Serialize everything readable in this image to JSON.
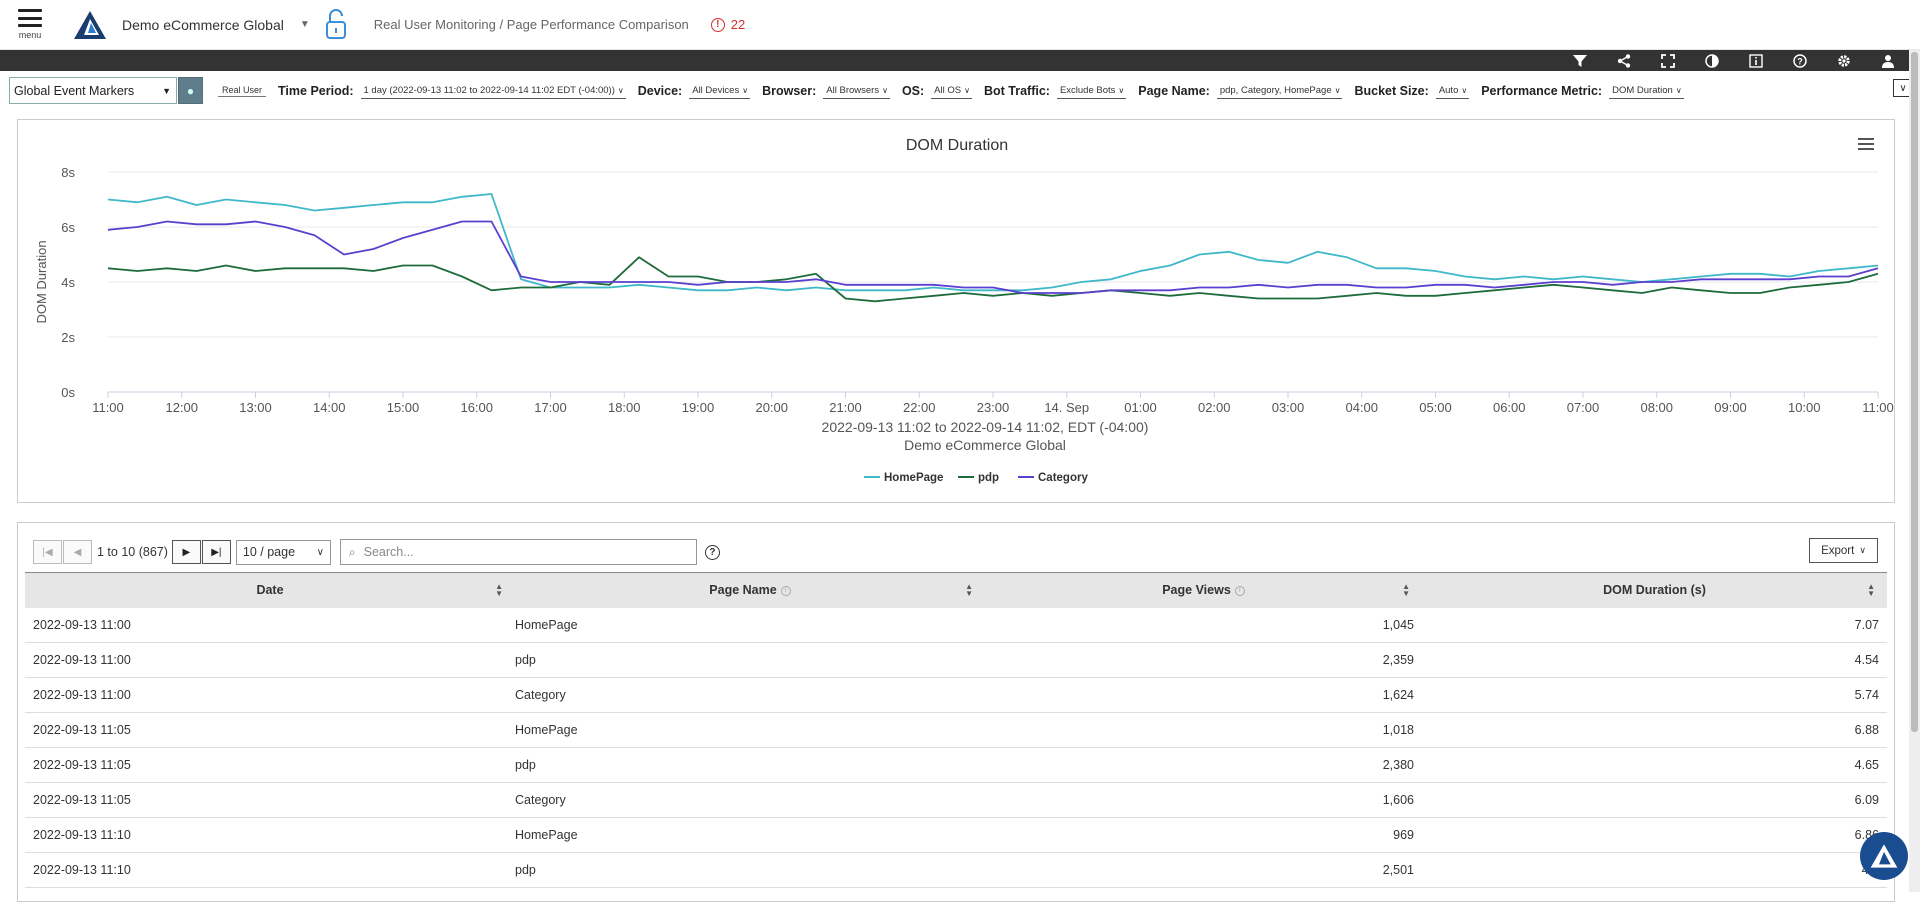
{
  "header": {
    "menu_label": "menu",
    "app_name": "Demo eCommerce Global",
    "breadcrumb": "Real User Monitoring / Page Performance Comparison",
    "alert_count": "22"
  },
  "toolbar": {
    "icons": [
      "filter-icon",
      "share-icon",
      "fullscreen-icon",
      "contrast-icon",
      "info-icon",
      "help-icon",
      "settings-icon",
      "user-icon"
    ]
  },
  "filters": {
    "event_markers": "Global Event Markers",
    "mode": "Real User",
    "time_period_label": "Time Period:",
    "time_period_value": "1 day (2022-09-13 11:02 to 2022-09-14 11:02 EDT (-04:00))",
    "device_label": "Device:",
    "device_value": "All Devices",
    "browser_label": "Browser:",
    "browser_value": "All Browsers",
    "os_label": "OS:",
    "os_value": "All OS",
    "bot_label": "Bot Traffic:",
    "bot_value": "Exclude Bots",
    "page_label": "Page Name:",
    "page_value": "pdp, Category, HomePage",
    "bucket_label": "Bucket Size:",
    "bucket_value": "Auto",
    "metric_label": "Performance Metric:",
    "metric_value": "DOM Duration"
  },
  "chart_data": {
    "type": "line",
    "title": "DOM Duration",
    "xlabel": "2022-09-13 11:02 to 2022-09-14 11:02, EDT (-04:00)",
    "subtitle": "Demo eCommerce Global",
    "ylabel": "DOM Duration",
    "ylim": [
      0,
      8
    ],
    "yticks": [
      "0s",
      "2s",
      "4s",
      "6s",
      "8s"
    ],
    "xticks": [
      "11:00",
      "12:00",
      "13:00",
      "14:00",
      "15:00",
      "16:00",
      "17:00",
      "18:00",
      "19:00",
      "20:00",
      "21:00",
      "22:00",
      "23:00",
      "14. Sep",
      "01:00",
      "02:00",
      "03:00",
      "04:00",
      "05:00",
      "06:00",
      "07:00",
      "08:00",
      "09:00",
      "10:00",
      "11:00"
    ],
    "x_hours": [
      0,
      1,
      2,
      3,
      4,
      5,
      6,
      7,
      8,
      9,
      10,
      11,
      12,
      13,
      14,
      15,
      16,
      17,
      18,
      19,
      20,
      21,
      22,
      23,
      24
    ],
    "grid": true,
    "legend": "bottom",
    "series": [
      {
        "name": "HomePage",
        "color": "#3fb8c9",
        "values": [
          7.0,
          6.9,
          7.1,
          6.8,
          7.0,
          6.9,
          6.8,
          6.6,
          6.7,
          6.8,
          6.9,
          6.9,
          7.1,
          7.2,
          4.1,
          3.8,
          3.8,
          3.8,
          3.9,
          3.8,
          3.7,
          3.7,
          3.8,
          3.7,
          3.8,
          3.7,
          3.7,
          3.7,
          3.8,
          3.7,
          3.7,
          3.7,
          3.8,
          4.0,
          4.1,
          4.4,
          4.6,
          5.0,
          5.1,
          4.8,
          4.7,
          5.1,
          4.9,
          4.5,
          4.5,
          4.4,
          4.2,
          4.1,
          4.2,
          4.1,
          4.2,
          4.1,
          4.0,
          4.1,
          4.2,
          4.3,
          4.3,
          4.2,
          4.4,
          4.5,
          4.6
        ]
      },
      {
        "name": "pdp",
        "color": "#1e6b3c",
        "values": [
          4.5,
          4.4,
          4.5,
          4.4,
          4.6,
          4.4,
          4.5,
          4.5,
          4.5,
          4.4,
          4.6,
          4.6,
          4.2,
          3.7,
          3.8,
          3.8,
          4.0,
          3.9,
          4.9,
          4.2,
          4.2,
          4.0,
          4.0,
          4.1,
          4.3,
          3.4,
          3.3,
          3.4,
          3.5,
          3.6,
          3.5,
          3.6,
          3.5,
          3.6,
          3.7,
          3.6,
          3.5,
          3.6,
          3.5,
          3.4,
          3.4,
          3.4,
          3.5,
          3.6,
          3.5,
          3.5,
          3.6,
          3.7,
          3.8,
          3.9,
          3.8,
          3.7,
          3.6,
          3.8,
          3.7,
          3.6,
          3.6,
          3.8,
          3.9,
          4.0,
          4.3
        ]
      },
      {
        "name": "Category",
        "color": "#5b3fcf",
        "values": [
          5.9,
          6.0,
          6.2,
          6.1,
          6.1,
          6.2,
          6.0,
          5.7,
          5.0,
          5.2,
          5.6,
          5.9,
          6.2,
          6.2,
          4.2,
          4.0,
          4.0,
          4.0,
          4.0,
          4.0,
          3.9,
          4.0,
          4.0,
          4.0,
          4.1,
          3.9,
          3.9,
          3.9,
          3.9,
          3.8,
          3.8,
          3.6,
          3.6,
          3.6,
          3.7,
          3.7,
          3.7,
          3.8,
          3.8,
          3.9,
          3.8,
          3.9,
          3.9,
          3.8,
          3.8,
          3.9,
          3.9,
          3.8,
          3.9,
          4.0,
          4.0,
          3.9,
          4.0,
          4.0,
          4.1,
          4.1,
          4.1,
          4.1,
          4.2,
          4.2,
          4.5
        ]
      }
    ]
  },
  "table": {
    "range_text": "1 to 10 (867)",
    "per_page": "10 / page",
    "search_placeholder": "Search...",
    "export_label": "Export",
    "columns": [
      "Date",
      "Page Name",
      "Page Views",
      "DOM Duration (s)"
    ],
    "rows": [
      [
        "2022-09-13 11:00",
        "HomePage",
        "1,045",
        "7.07"
      ],
      [
        "2022-09-13 11:00",
        "pdp",
        "2,359",
        "4.54"
      ],
      [
        "2022-09-13 11:00",
        "Category",
        "1,624",
        "5.74"
      ],
      [
        "2022-09-13 11:05",
        "HomePage",
        "1,018",
        "6.88"
      ],
      [
        "2022-09-13 11:05",
        "pdp",
        "2,380",
        "4.65"
      ],
      [
        "2022-09-13 11:05",
        "Category",
        "1,606",
        "6.09"
      ],
      [
        "2022-09-13 11:10",
        "HomePage",
        "969",
        "6.86"
      ],
      [
        "2022-09-13 11:10",
        "pdp",
        "2,501",
        "4.5"
      ]
    ]
  }
}
